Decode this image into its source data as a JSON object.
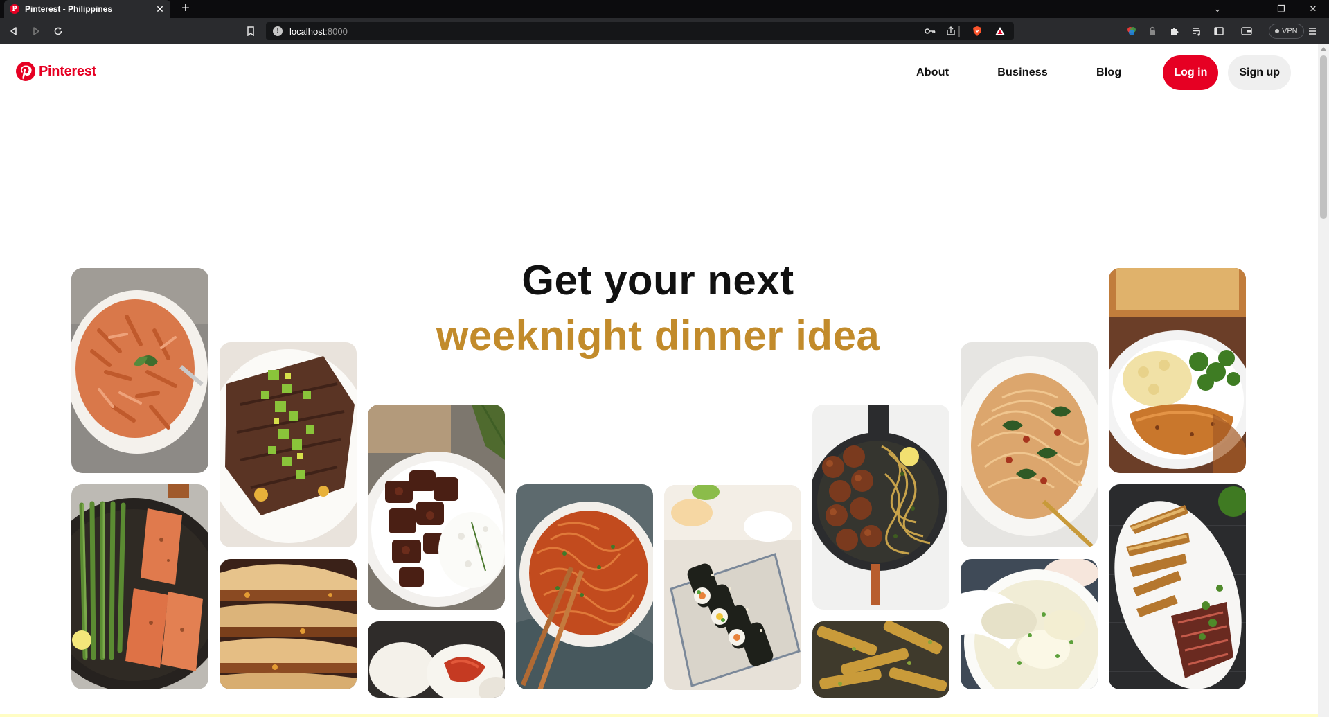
{
  "browser": {
    "tab_title": "Pinterest - Philippines",
    "tab_favicon": "P",
    "new_tab_label": "+",
    "url_host": "localhost",
    "url_port": ":8000",
    "vpn_label": "VPN"
  },
  "header": {
    "logo_text": "Pinterest",
    "nav": {
      "about": "About",
      "business": "Business",
      "blog": "Blog"
    },
    "login_label": "Log in",
    "signup_label": "Sign up"
  },
  "hero": {
    "line1": "Get your next",
    "line2": "weeknight dinner idea",
    "accent_color": "#c28b2b"
  },
  "pins": [
    {
      "name": "penne-pasta-pin",
      "subject": "penne pasta in creamy tomato sauce"
    },
    {
      "name": "salmon-asparagus-pin",
      "subject": "salmon with asparagus in skillet"
    },
    {
      "name": "steak-avocado-salsa-pin",
      "subject": "steak with avocado salsa"
    },
    {
      "name": "crunchwrap-pin",
      "subject": "stacked crunchwrap tortillas"
    },
    {
      "name": "beef-rice-bowl-pin",
      "subject": "braised beef with rice"
    },
    {
      "name": "steamed-bun-pin",
      "subject": "steamed buns"
    },
    {
      "name": "spicy-noodles-pin",
      "subject": "spicy noodles with chopsticks"
    },
    {
      "name": "kimbap-rolls-pin",
      "subject": "kimbap rolls"
    },
    {
      "name": "meatballs-zoodles-pin",
      "subject": "meatballs with zucchini noodles"
    },
    {
      "name": "zucchini-fries-pin",
      "subject": "crispy zucchini fries"
    },
    {
      "name": "creamy-spaghetti-pin",
      "subject": "creamy spinach spaghetti"
    },
    {
      "name": "wonton-soup-pin",
      "subject": "wonton soup"
    },
    {
      "name": "chicken-mash-pin",
      "subject": "chicken with mashed potatoes and broccoli"
    },
    {
      "name": "steak-potato-wedges-pin",
      "subject": "steak with potato wedges"
    }
  ],
  "colors": {
    "brand_red": "#e60023",
    "signup_bg": "#efefef"
  }
}
